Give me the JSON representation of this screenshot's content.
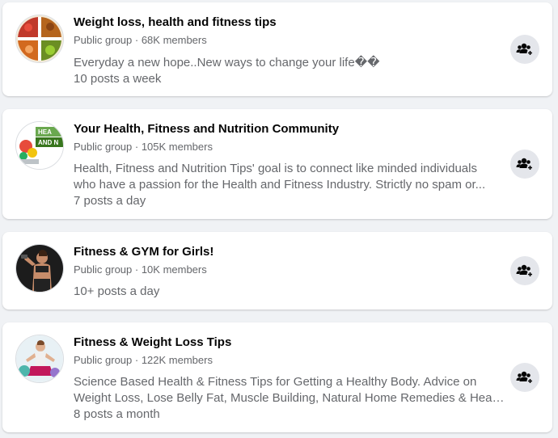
{
  "groups": [
    {
      "name": "Weight loss, health and fitness tips",
      "meta": "Public group · 68K members",
      "description_lines": [
        "Everyday a new hope..New ways to change your life��"
      ],
      "frequency": "10 posts a week",
      "avatar_icon": "food-plate-avatar"
    },
    {
      "name": "Your Health, Fitness and Nutrition Community",
      "meta": "Public group · 105K members",
      "description_lines": [
        "Health, Fitness and Nutrition Tips' goal is to connect like minded individuals",
        "who have a passion for the Health and Fitness Industry. Strictly no spam or..."
      ],
      "frequency": "7 posts a day",
      "avatar_icon": "health-nutrition-avatar"
    },
    {
      "name": "Fitness & GYM for Girls!",
      "meta": "Public group · 10K members",
      "description_lines": [],
      "frequency": "10+ posts a day",
      "avatar_icon": "gym-woman-avatar"
    },
    {
      "name": "Fitness & Weight Loss Tips",
      "meta": "Public group · 122K members",
      "description_lines": [
        "Science Based Health & Fitness Tips for Getting a Healthy Body. Advice on",
        "Weight Loss, Lose Belly Fat, Muscle Building, Natural Home Remedies & Healt..."
      ],
      "frequency": "8 posts a month",
      "avatar_icon": "yoga-woman-avatar"
    }
  ],
  "join_button_icon": "group-join-icon",
  "colors": {
    "background": "#f0f2f5",
    "card": "#ffffff",
    "title_text": "#050505",
    "secondary_text": "#65676b",
    "button_bg": "#e4e6eb"
  }
}
